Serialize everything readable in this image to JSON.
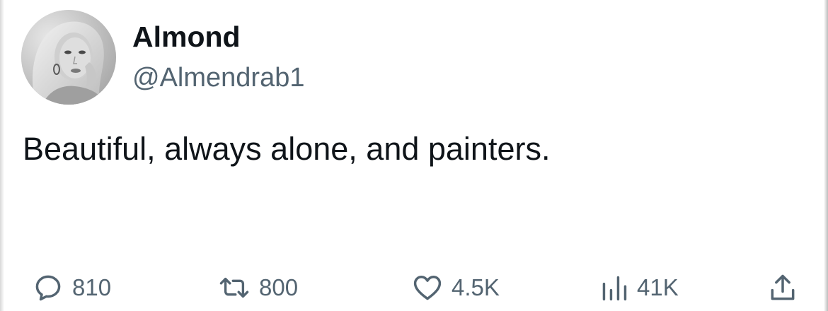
{
  "author": {
    "display_name": "Almond",
    "handle": "@Almendrab1"
  },
  "tweet": {
    "text": "Beautiful, always alone, and painters."
  },
  "actions": {
    "replies": {
      "icon": "reply-bubble-icon",
      "count": "810"
    },
    "retweets": {
      "icon": "retweet-icon",
      "count": "800"
    },
    "likes": {
      "icon": "heart-icon",
      "count": "4.5K"
    },
    "views": {
      "icon": "views-bar-chart-icon",
      "count": "41K"
    },
    "share": {
      "icon": "share-upload-icon"
    }
  },
  "colors": {
    "primary_text": "#0f1419",
    "secondary_text": "#536471",
    "background": "#ffffff"
  }
}
